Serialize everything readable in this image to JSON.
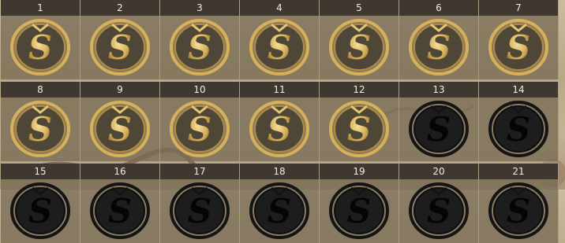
{
  "grid": {
    "cells": [
      {
        "number": "1",
        "status": "unlocked"
      },
      {
        "number": "2",
        "status": "unlocked"
      },
      {
        "number": "3",
        "status": "unlocked"
      },
      {
        "number": "4",
        "status": "unlocked"
      },
      {
        "number": "5",
        "status": "unlocked"
      },
      {
        "number": "6",
        "status": "unlocked"
      },
      {
        "number": "7",
        "status": "unlocked"
      },
      {
        "number": "8",
        "status": "unlocked"
      },
      {
        "number": "9",
        "status": "unlocked"
      },
      {
        "number": "10",
        "status": "unlocked"
      },
      {
        "number": "11",
        "status": "unlocked"
      },
      {
        "number": "12",
        "status": "unlocked"
      },
      {
        "number": "13",
        "status": "locked"
      },
      {
        "number": "14",
        "status": "locked"
      },
      {
        "number": "15",
        "status": "locked"
      },
      {
        "number": "16",
        "status": "locked"
      },
      {
        "number": "17",
        "status": "locked"
      },
      {
        "number": "18",
        "status": "locked"
      },
      {
        "number": "19",
        "status": "locked"
      },
      {
        "number": "20",
        "status": "locked"
      },
      {
        "number": "21",
        "status": "locked"
      }
    ]
  },
  "icon": "s-medal-icon",
  "colors": {
    "header_bg": "#3e3831",
    "header_text": "#f2ece0",
    "gold": "#d9b662",
    "locked": "#141414"
  }
}
